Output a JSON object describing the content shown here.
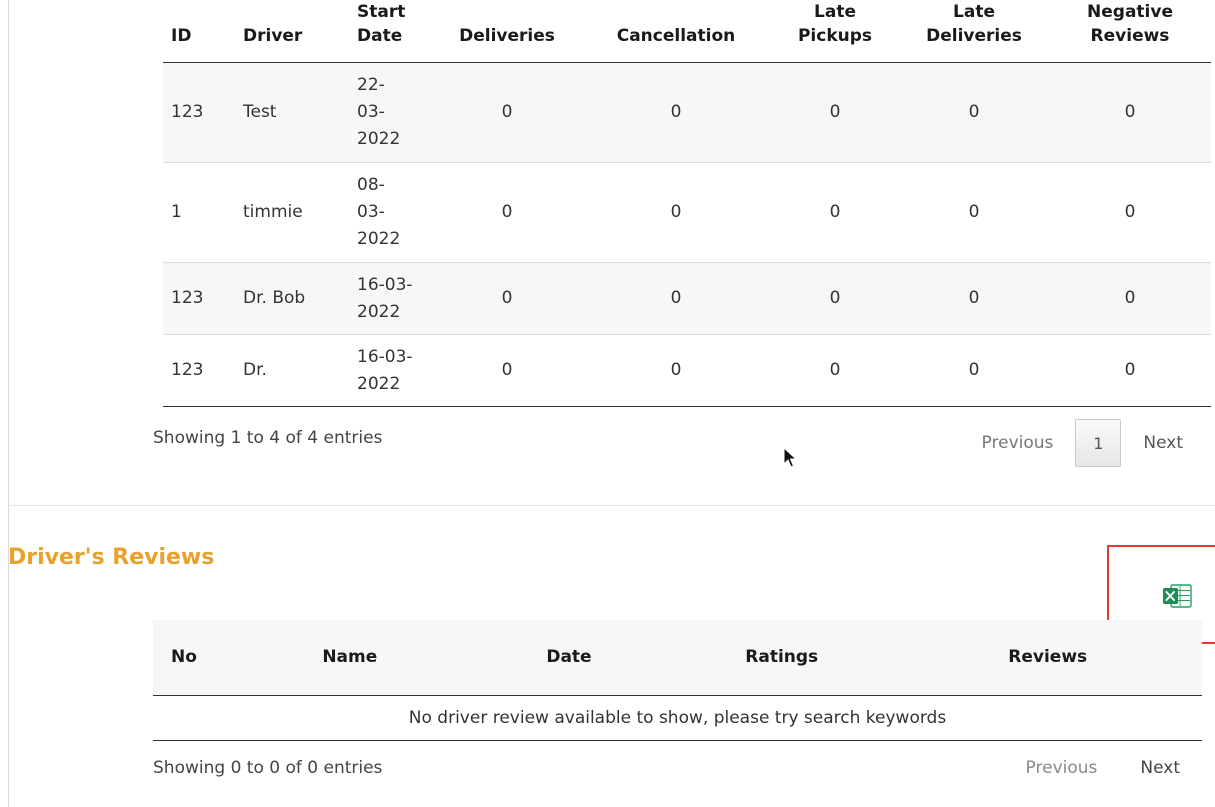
{
  "performance": {
    "headers": [
      [
        "ID"
      ],
      [
        "Driver"
      ],
      [
        "Start",
        "Date"
      ],
      [
        "Deliveries"
      ],
      [
        "Cancellation"
      ],
      [
        "Late",
        "Pickups"
      ],
      [
        "Late",
        "Deliveries"
      ],
      [
        "Negative",
        "Reviews"
      ]
    ],
    "rows": [
      {
        "id": "123",
        "driver": "Test",
        "date": [
          "22-",
          "03-",
          "2022"
        ],
        "deliveries": "0",
        "cancellation": "0",
        "late_pickups": "0",
        "late_deliveries": "0",
        "negative_reviews": "0"
      },
      {
        "id": "1",
        "driver": "timmie",
        "date": [
          "08-",
          "03-",
          "2022"
        ],
        "deliveries": "0",
        "cancellation": "0",
        "late_pickups": "0",
        "late_deliveries": "0",
        "negative_reviews": "0"
      },
      {
        "id": "123",
        "driver": "Dr. Bob",
        "date": [
          "16-03-",
          "2022"
        ],
        "deliveries": "0",
        "cancellation": "0",
        "late_pickups": "0",
        "late_deliveries": "0",
        "negative_reviews": "0"
      },
      {
        "id": "123",
        "driver": "Dr.",
        "date": [
          "16-03-",
          "2022"
        ],
        "deliveries": "0",
        "cancellation": "0",
        "late_pickups": "0",
        "late_deliveries": "0",
        "negative_reviews": "0"
      }
    ],
    "showing": "Showing 1 to 4 of 4 entries",
    "pager": {
      "previous": "Previous",
      "page": "1",
      "next": "Next"
    }
  },
  "reviews": {
    "title": "Driver's Reviews",
    "export_icon": "excel-icon",
    "headers": [
      "No",
      "Name",
      "Date",
      "Ratings",
      "Reviews"
    ],
    "empty_message": "No driver review available to show, please try search keywords",
    "showing": "Showing 0 to 0 of 0 entries",
    "pager": {
      "previous": "Previous",
      "next": "Next"
    }
  },
  "colors": {
    "section_title": "#e8a12a",
    "highlight": "#e53935",
    "excel_green": "#21a366"
  }
}
